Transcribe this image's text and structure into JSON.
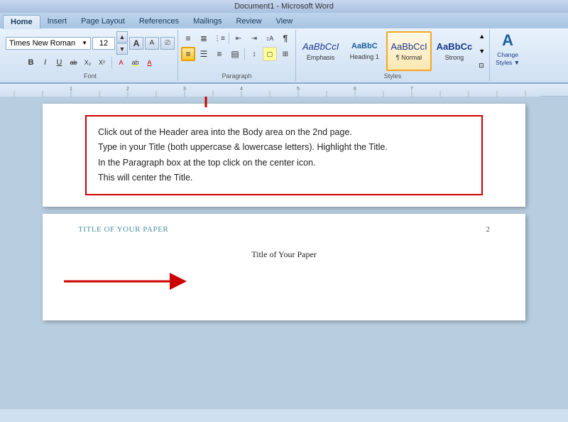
{
  "titlebar": {
    "text": "Document1 - Microsoft Word"
  },
  "tabs": [
    {
      "label": "Home",
      "active": true
    },
    {
      "label": "Insert",
      "active": false
    },
    {
      "label": "Page Layout",
      "active": false
    },
    {
      "label": "References",
      "active": false
    },
    {
      "label": "Mailings",
      "active": false
    },
    {
      "label": "Review",
      "active": false
    },
    {
      "label": "View",
      "active": false
    }
  ],
  "ribbon": {
    "font": {
      "name": "Times New Roman",
      "size": "12",
      "label": "Font"
    },
    "paragraph": {
      "label": "Paragraph"
    },
    "styles": {
      "label": "Styles",
      "items": [
        {
          "name": "Emphasis",
          "preview": "AaBbCcI",
          "class": "emphasis"
        },
        {
          "name": "Heading 1",
          "preview": "AaBbC",
          "class": "heading"
        },
        {
          "name": "¶ Normal",
          "preview": "AaBbCcI",
          "class": "normal",
          "active": true
        },
        {
          "name": "Strong",
          "preview": "AaBbCc",
          "class": "strong"
        }
      ],
      "change_styles_label": "Change\nStyles ="
    }
  },
  "instruction": {
    "lines": [
      "Click out of the Header area into the Body area on the 2nd page.",
      "Type in your Title (both uppercase & lowercase letters). Highlight the Title.",
      "In the Paragraph box at the top click on the center icon.",
      "This will center the Title."
    ]
  },
  "page2": {
    "header": "TITLE OF YOUR PAPER",
    "page_number": "2",
    "body_text": "Title of Your Paper"
  }
}
